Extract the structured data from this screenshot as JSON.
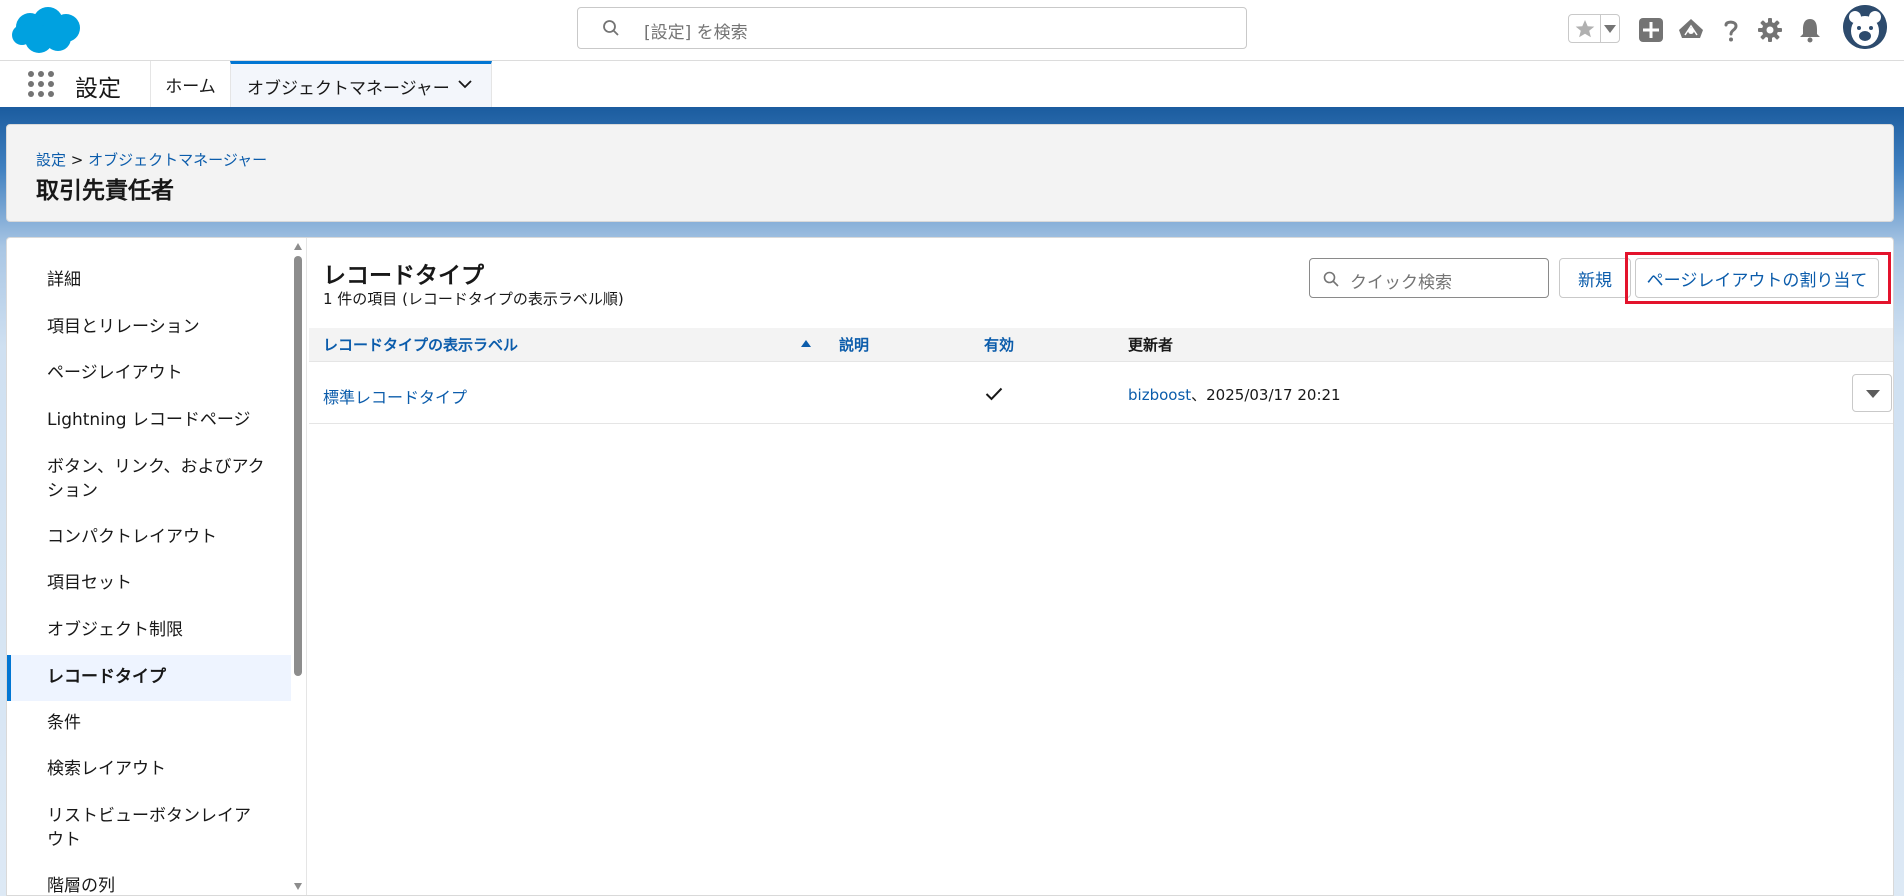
{
  "header": {
    "search_placeholder": "[設定] を検索"
  },
  "context_bar": {
    "app_name": "設定",
    "tabs": [
      {
        "label": "ホーム"
      },
      {
        "label": "オブジェクトマネージャー"
      }
    ]
  },
  "page_header": {
    "breadcrumb_root": "設定",
    "breadcrumb_sep": ">",
    "breadcrumb_current": "オブジェクトマネージャー",
    "title": "取引先責任者"
  },
  "sidebar": {
    "items": [
      {
        "label": "詳細"
      },
      {
        "label": "項目とリレーション"
      },
      {
        "label": "ページレイアウト"
      },
      {
        "label": "Lightning レコードページ"
      },
      {
        "label": "ボタン、リンク、およびアクション"
      },
      {
        "label": "コンパクトレイアウト"
      },
      {
        "label": "項目セット"
      },
      {
        "label": "オブジェクト制限"
      },
      {
        "label": "レコードタイプ"
      },
      {
        "label": "条件"
      },
      {
        "label": "検索レイアウト"
      },
      {
        "label": "リストビューボタンレイアウト"
      },
      {
        "label": "階層の列"
      }
    ],
    "active_index": 8
  },
  "content": {
    "title": "レコードタイプ",
    "subtitle": "1 件の項目 (レコードタイプの表示ラベル順)",
    "quick_search_placeholder": "クイック検索",
    "new_button": "新規",
    "assign_button": "ページレイアウトの割り当て",
    "columns": [
      "レコードタイプの表示ラベル",
      "説明",
      "有効",
      "更新者"
    ],
    "rows": [
      {
        "label": "標準レコードタイプ",
        "description": "",
        "active": true,
        "modified_by_user": "bizboost",
        "modified_by_date": "、2025/03/17 20:21"
      }
    ]
  },
  "colors": {
    "brand_blue": "#0176d3",
    "link_blue": "#0b5cab",
    "highlight_red": "#e3132c"
  }
}
